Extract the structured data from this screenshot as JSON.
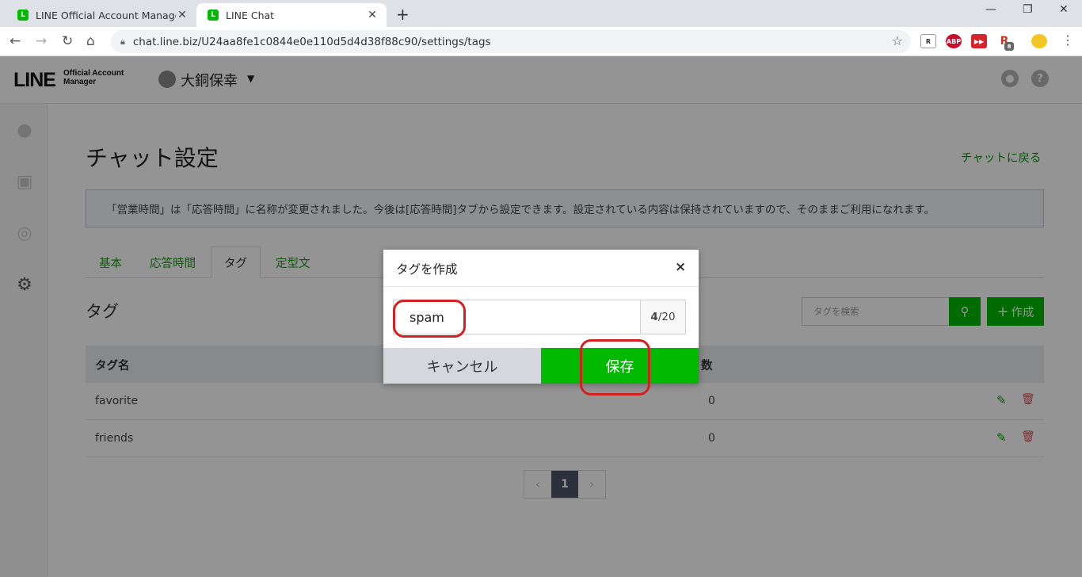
{
  "browser": {
    "tabs": [
      {
        "title": "LINE Official Account Manager",
        "favicon": "L"
      },
      {
        "title": "LINE Chat",
        "favicon": "L"
      }
    ],
    "url": "chat.line.biz/U24aa8fe1c0844e0e110d5d4d38f88c90/settings/tags",
    "extensions": [
      {
        "label": "R",
        "color": "#ffffff"
      },
      {
        "label": "ABP",
        "color": "#c70d2c"
      },
      {
        "label": "▶▶",
        "color": "#d9232d"
      },
      {
        "label": "R",
        "color": "#c0392b"
      },
      {
        "label": "8",
        "color": "#666666"
      }
    ]
  },
  "header": {
    "logo_main": "LINE",
    "logo_sub": "Official Account Manager",
    "account_name": "大銅保幸"
  },
  "page": {
    "title": "チャット設定",
    "back_link": "チャットに戻る",
    "notice": "「営業時間」は「応答時間」に名称が変更されました。今後は[応答時間]タブから設定できます。設定されている内容は保持されていますので、そのままご利用になれます。"
  },
  "tabs": [
    {
      "label": "基本"
    },
    {
      "label": "応答時間"
    },
    {
      "label": "タグ"
    },
    {
      "label": "定型文"
    }
  ],
  "tag_section": {
    "title": "タグ",
    "search_placeholder": "タグを検索",
    "create_label": "作成"
  },
  "table": {
    "headers": [
      "タグ名",
      "数"
    ],
    "rows": [
      {
        "name": "favorite",
        "count": "0"
      },
      {
        "name": "friends",
        "count": "0"
      }
    ]
  },
  "pagination": {
    "current": "1"
  },
  "modal": {
    "title": "タグを作成",
    "input_value": "spam",
    "count_current": "4",
    "count_max": "/20",
    "cancel_label": "キャンセル",
    "save_label": "保存"
  },
  "colors": {
    "brand_green": "#00b900",
    "annotation_red": "#d32020"
  }
}
